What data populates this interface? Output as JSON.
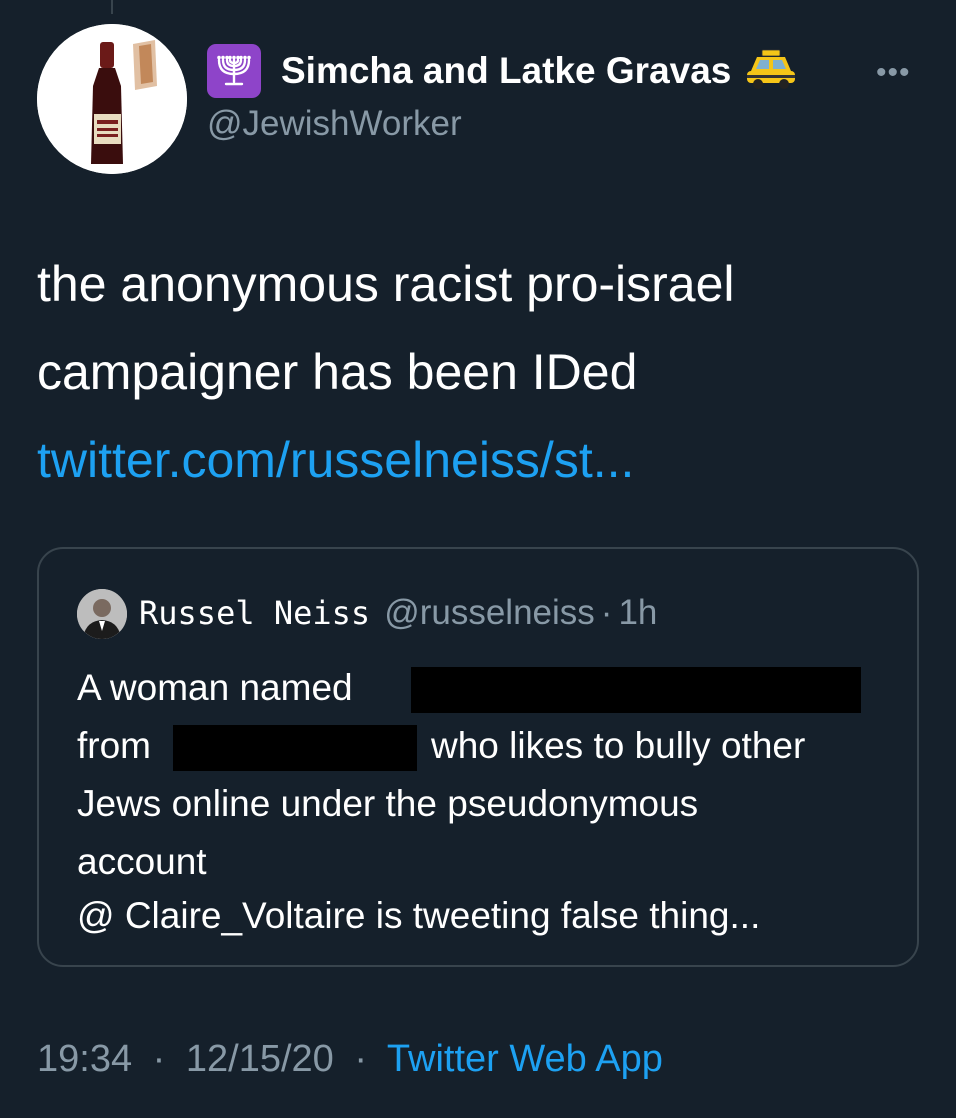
{
  "author": {
    "display_name": "Simcha and Latke Gravas",
    "handle": "@JewishWorker",
    "badge_icon": "menorah-icon",
    "name_emoji_icon": "taxi-icon",
    "avatar_icon": "wine-bottle-icon"
  },
  "tweet": {
    "line1": "the anonymous racist pro-israel",
    "line2": "campaigner has been IDed",
    "link": "twitter.com/russelneiss/st..."
  },
  "quoted": {
    "name": "Russel Neiss",
    "handle": "@russelneiss",
    "separator": "·",
    "time": "1h",
    "line1": "A woman named",
    "line2_start": "from",
    "line2_end": "who likes to bully other",
    "line3": "Jews online under the pseudonymous",
    "line4": "account",
    "line5": "@ Claire_Voltaire is tweeting false thing..."
  },
  "footer": {
    "time": "19:34",
    "date": "12/15/20",
    "separator": "·",
    "app": "Twitter Web App"
  },
  "colors": {
    "background": "#15202b",
    "secondary_text": "#8899a6",
    "link": "#1da1f2",
    "border": "#38444d"
  }
}
